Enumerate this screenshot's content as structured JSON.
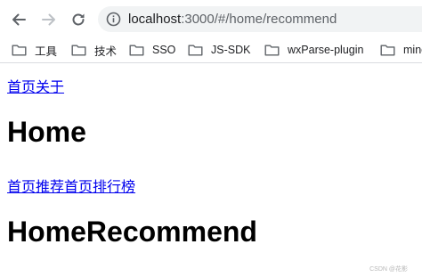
{
  "browser": {
    "url_host": "localhost",
    "url_rest": ":3000/#/home/recommend",
    "nav": {
      "back_icon": "arrow-left-icon",
      "forward_icon": "arrow-right-icon",
      "reload_icon": "reload-icon",
      "info_icon": "info-icon"
    }
  },
  "bookmarks": [
    {
      "label": "工具",
      "icon": "folder-icon"
    },
    {
      "label": "技术",
      "icon": "folder-icon"
    },
    {
      "label": "SSO",
      "icon": "folder-icon"
    },
    {
      "label": "JS-SDK",
      "icon": "folder-icon"
    },
    {
      "label": "wxParse-plugin",
      "icon": "folder-icon"
    },
    {
      "label": "mine",
      "icon": "folder-icon"
    }
  ],
  "page": {
    "nav_links": [
      "首页",
      "关于"
    ],
    "title": "Home",
    "sub_links": [
      "首页推荐",
      "首页排行榜"
    ],
    "subtitle": "HomeRecommend"
  },
  "watermark": "CSDN @花影",
  "colors": {
    "link": "#0000ee",
    "urlbar_bg": "#f1f3f4",
    "icon": "#5f6368"
  }
}
